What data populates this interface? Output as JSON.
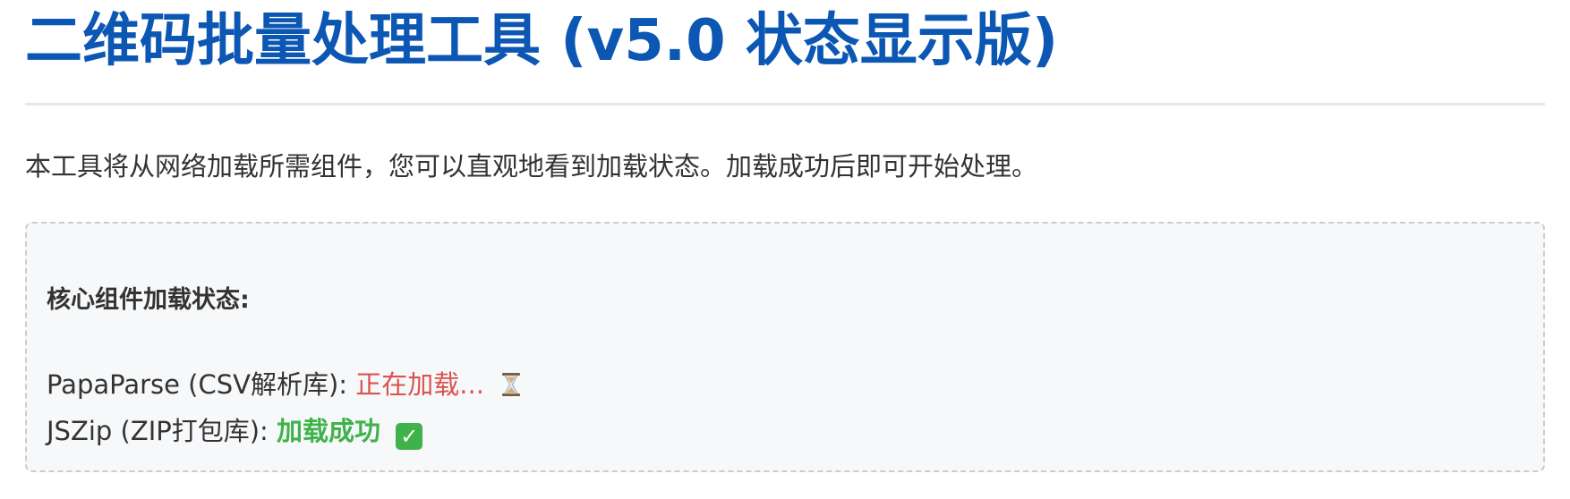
{
  "header": {
    "title": "二维码批量处理工具 (v5.0 状态显示版)"
  },
  "intro": {
    "text": "本工具将从网络加载所需组件，您可以直观地看到加载状态。加载成功后即可开始处理。"
  },
  "status_panel": {
    "heading": "核心组件加载状态:",
    "components": [
      {
        "name": "PapaParse (CSV解析库):",
        "state": "正在加载...",
        "icon": "hourglass-icon",
        "state_color": "#d9534f"
      },
      {
        "name": "JSZip (ZIP打包库):",
        "state": "加载成功",
        "icon": "check-mark-icon",
        "state_color": "#3fb24a"
      }
    ]
  },
  "colors": {
    "title": "#0b57b3",
    "panel_background": "#f7f8fa",
    "panel_border": "#c9ccd0"
  }
}
